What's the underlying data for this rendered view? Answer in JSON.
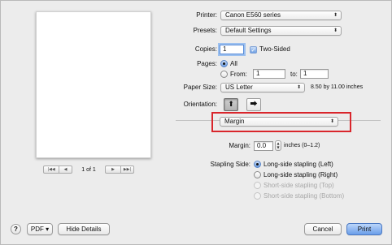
{
  "preview": {
    "page_count": "1 of 1",
    "nav": {
      "first": "|◀◀",
      "prev": "◀",
      "next": "▶",
      "last": "▶▶|"
    }
  },
  "printer": {
    "label": "Printer:",
    "value": "Canon E560 series"
  },
  "presets": {
    "label": "Presets:",
    "value": "Default Settings"
  },
  "copies": {
    "label": "Copies:",
    "value": "1",
    "two_sided_label": "Two-Sided",
    "two_sided_checked": true
  },
  "pages": {
    "label": "Pages:",
    "all_label": "All",
    "from_label": "From:",
    "from_value": "1",
    "to_label": "to:",
    "to_value": "1"
  },
  "paper_size": {
    "label": "Paper Size:",
    "value": "US Letter",
    "dimensions": "8.50 by 11.00 inches"
  },
  "orientation": {
    "label": "Orientation:"
  },
  "panel_select": {
    "value": "Margin"
  },
  "margin": {
    "label": "Margin:",
    "value": "0.0",
    "unit": "inches (0–1.2)"
  },
  "stapling": {
    "label": "Stapling Side:",
    "options": [
      {
        "label": "Long-side stapling (Left)",
        "selected": true,
        "enabled": true
      },
      {
        "label": "Long-side stapling (Right)",
        "selected": false,
        "enabled": true
      },
      {
        "label": "Short-side stapling (Top)",
        "selected": false,
        "enabled": false
      },
      {
        "label": "Short-side stapling (Bottom)",
        "selected": false,
        "enabled": false
      }
    ]
  },
  "footer": {
    "help": "?",
    "pdf_label": "PDF ▾",
    "hide_details": "Hide Details",
    "cancel": "Cancel",
    "print": "Print"
  },
  "colors": {
    "highlight": "#d9262c",
    "accent": "#6a9ee9"
  }
}
